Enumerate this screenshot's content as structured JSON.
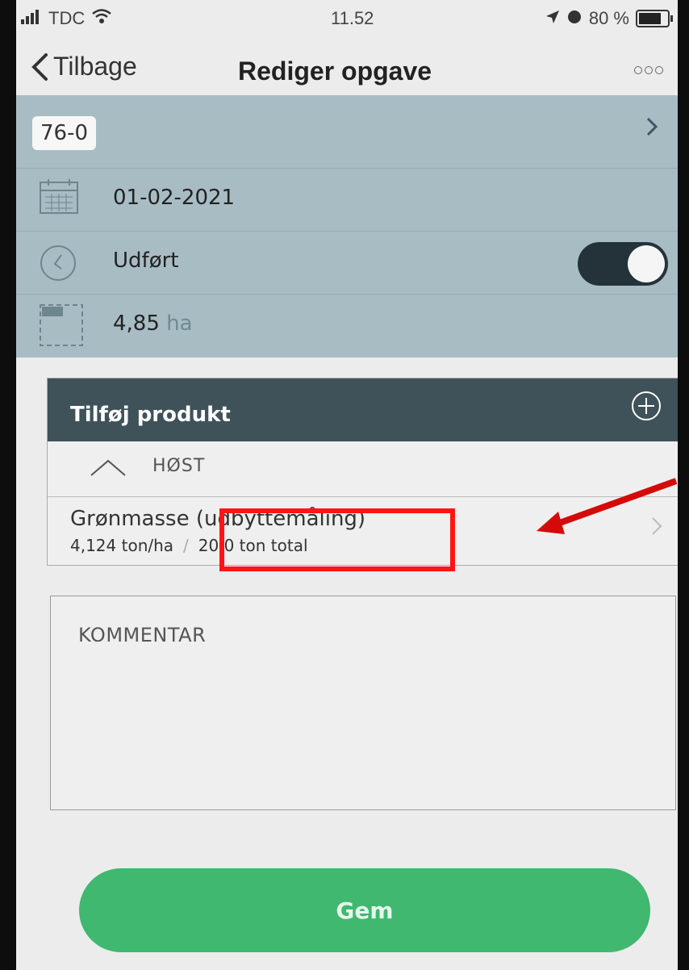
{
  "status_bar": {
    "carrier": "TDC",
    "time": "11.52",
    "battery": "80 %",
    "battery_level": 0.8
  },
  "nav": {
    "back_label": "Tilbage",
    "title": "Rediger opgave"
  },
  "field": {
    "id": "76-0",
    "date": "01-02-2021",
    "status": "Udført",
    "status_on": true,
    "area_value": "4,85",
    "area_unit": "ha"
  },
  "products": {
    "header": "Tilføj produkt",
    "group": "HØST",
    "items": [
      {
        "name": "Grønmasse",
        "name_detail": "(udbyttemåling)",
        "rate": "4,124 ton/ha",
        "separator": "/",
        "total": "20,0 ton total"
      }
    ]
  },
  "comment": {
    "label": "KOMMENTAR"
  },
  "save_label": "Gem",
  "colors": {
    "header_bg": "#a8bcc4",
    "panel_head": "#3f5259",
    "save_green": "#40b870",
    "annotation_red": "#ff1515"
  }
}
